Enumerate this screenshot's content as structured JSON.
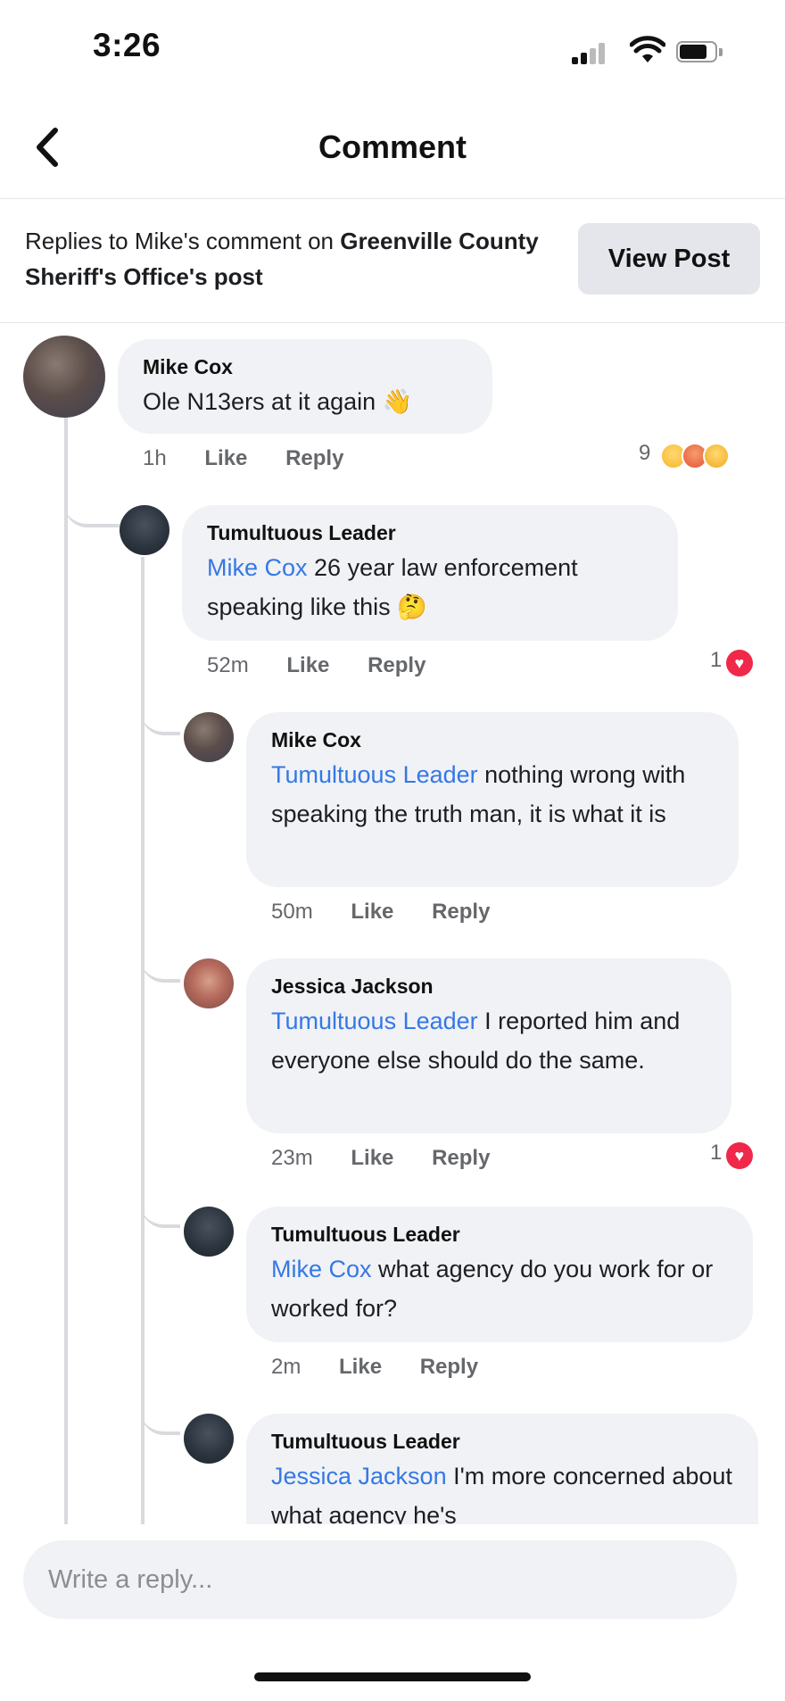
{
  "status_bar": {
    "time": "3:26"
  },
  "nav": {
    "title": "Comment"
  },
  "context": {
    "prefix": "Replies to Mike's comment on ",
    "page_name": "Greenville County Sheriff's Office",
    "suffix": "'s post",
    "view_post_label": "View Post"
  },
  "comments": [
    {
      "author": "Mike Cox",
      "text": "Ole N13ers at it again",
      "emoji": "👋",
      "time": "1h",
      "like": "Like",
      "reply": "Reply",
      "reaction_count": "9",
      "reactions": [
        "haha",
        "angry",
        "wow"
      ]
    },
    {
      "author": "Tumultuous Leader",
      "mention": "Mike Cox",
      "text": " 26 year law enforcement speaking like this",
      "emoji": "🤔",
      "time": "52m",
      "like": "Like",
      "reply": "Reply",
      "reaction_count": "1",
      "reactions": [
        "love"
      ]
    },
    {
      "author": "Mike Cox",
      "mention": "Tumultuous Leader",
      "text": " nothing wrong with speaking the truth man, it is what it is",
      "time": "50m",
      "like": "Like",
      "reply": "Reply"
    },
    {
      "author": "Jessica Jackson",
      "mention": "Tumultuous Leader",
      "text": " I reported him and everyone else should do the same.",
      "time": "23m",
      "like": "Like",
      "reply": "Reply",
      "reaction_count": "1",
      "reactions": [
        "love"
      ]
    },
    {
      "author": "Tumultuous Leader",
      "mention": "Mike Cox",
      "text": " what agency do you work for or worked for?",
      "time": "2m",
      "like": "Like",
      "reply": "Reply"
    },
    {
      "author": "Tumultuous Leader",
      "mention": "Jessica Jackson",
      "text": " I'm more concerned about what agency he's"
    }
  ],
  "reply_input": {
    "placeholder": "Write a reply..."
  },
  "colors": {
    "mention": "#3578e5",
    "bubble": "#f0f2f5",
    "love": "#f02849"
  }
}
